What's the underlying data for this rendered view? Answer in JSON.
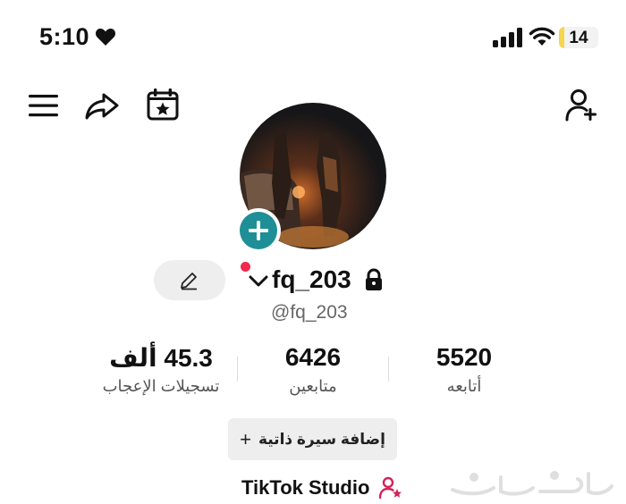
{
  "status_bar": {
    "time": "5:10",
    "battery_level": "14",
    "battery_fill_fraction": 0.14,
    "icons": [
      "heart-icon",
      "signal-icon",
      "wifi-icon",
      "battery-icon"
    ]
  },
  "toolbar": {
    "icons": [
      "menu-icon",
      "share-icon",
      "calendar-star-icon",
      "add-user-icon"
    ]
  },
  "profile": {
    "username": "fq_203",
    "handle": "@fq_203"
  },
  "stats": {
    "likes": {
      "value": "45.3 ألف",
      "label": "تسجيلات الإعجاب"
    },
    "followers": {
      "value": "6426",
      "label": "متابعين"
    },
    "following": {
      "value": "5520",
      "label": "أتابعه"
    }
  },
  "bio_button": {
    "plus": "+",
    "label": "إضافة سيرة ذاتية"
  },
  "studio": {
    "label": "TikTok Studio"
  },
  "colors": {
    "accent_teal": "#1e8f97",
    "live_dot": "#f0294f",
    "studio_icon": "#d1245c",
    "battery_yellow": "#f7d54a"
  }
}
